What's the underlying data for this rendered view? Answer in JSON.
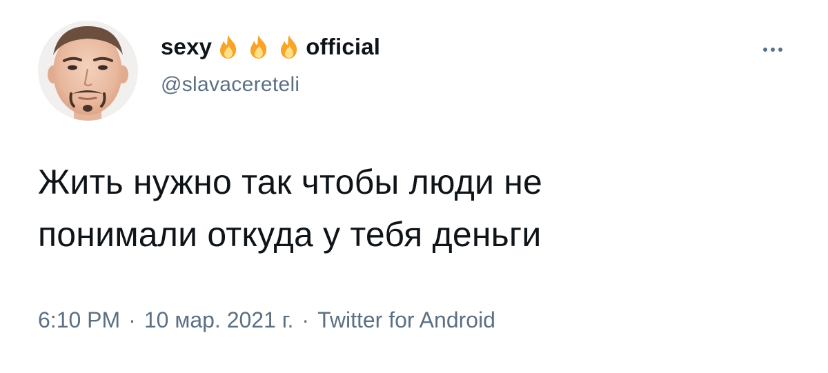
{
  "author": {
    "name_prefix": "sexy",
    "name_suffix": "official",
    "name_emoji": [
      "fire-icon",
      "fire-icon",
      "fire-icon"
    ],
    "handle": "@slavacereteli"
  },
  "menu": {
    "icon": "more-horizontal-icon"
  },
  "tweet": {
    "text_lines": [
      "Жить нужно так чтобы люди не",
      "понимали откуда у тебя деньги"
    ]
  },
  "meta": {
    "time": "6:10 PM",
    "separator": "·",
    "date": "10 мар. 2021 г.",
    "source": "Twitter for Android"
  },
  "colors": {
    "text_primary": "#0f1419",
    "text_secondary": "#5b7083",
    "background": "#ffffff",
    "fire_outer": "#f7a428",
    "fire_inner": "#fde08a"
  }
}
